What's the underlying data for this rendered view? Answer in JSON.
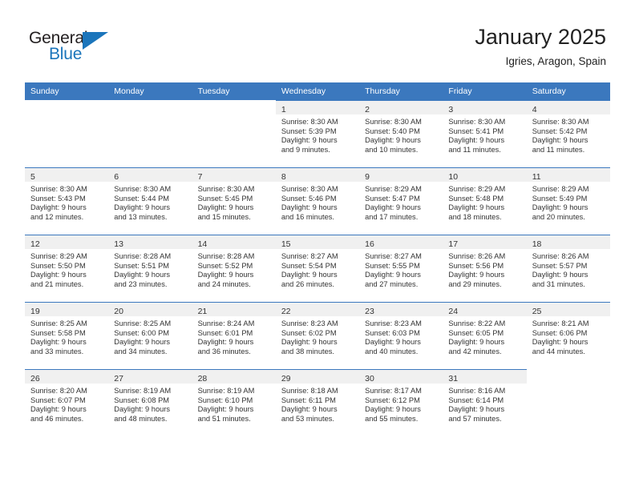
{
  "brand": {
    "name_part1": "General",
    "name_part2": "Blue",
    "accent_color": "#1b75bb"
  },
  "header": {
    "title": "January 2025",
    "subtitle": "Igries, Aragon, Spain"
  },
  "theme": {
    "header_row_color": "#3b78be",
    "cell_band_color": "#f0f0f0",
    "cell_top_border_color": "#3b78be"
  },
  "weekday_headers": [
    "Sunday",
    "Monday",
    "Tuesday",
    "Wednesday",
    "Thursday",
    "Friday",
    "Saturday"
  ],
  "weeks": [
    [
      {
        "day": "",
        "lines": [
          "",
          "",
          "",
          ""
        ],
        "empty": true
      },
      {
        "day": "",
        "lines": [
          "",
          "",
          "",
          ""
        ],
        "empty": true
      },
      {
        "day": "",
        "lines": [
          "",
          "",
          "",
          ""
        ],
        "empty": true
      },
      {
        "day": "1",
        "lines": [
          "Sunrise: 8:30 AM",
          "Sunset: 5:39 PM",
          "Daylight: 9 hours",
          "and 9 minutes."
        ],
        "empty": false
      },
      {
        "day": "2",
        "lines": [
          "Sunrise: 8:30 AM",
          "Sunset: 5:40 PM",
          "Daylight: 9 hours",
          "and 10 minutes."
        ],
        "empty": false
      },
      {
        "day": "3",
        "lines": [
          "Sunrise: 8:30 AM",
          "Sunset: 5:41 PM",
          "Daylight: 9 hours",
          "and 11 minutes."
        ],
        "empty": false
      },
      {
        "day": "4",
        "lines": [
          "Sunrise: 8:30 AM",
          "Sunset: 5:42 PM",
          "Daylight: 9 hours",
          "and 11 minutes."
        ],
        "empty": false
      }
    ],
    [
      {
        "day": "5",
        "lines": [
          "Sunrise: 8:30 AM",
          "Sunset: 5:43 PM",
          "Daylight: 9 hours",
          "and 12 minutes."
        ],
        "empty": false
      },
      {
        "day": "6",
        "lines": [
          "Sunrise: 8:30 AM",
          "Sunset: 5:44 PM",
          "Daylight: 9 hours",
          "and 13 minutes."
        ],
        "empty": false
      },
      {
        "day": "7",
        "lines": [
          "Sunrise: 8:30 AM",
          "Sunset: 5:45 PM",
          "Daylight: 9 hours",
          "and 15 minutes."
        ],
        "empty": false
      },
      {
        "day": "8",
        "lines": [
          "Sunrise: 8:30 AM",
          "Sunset: 5:46 PM",
          "Daylight: 9 hours",
          "and 16 minutes."
        ],
        "empty": false
      },
      {
        "day": "9",
        "lines": [
          "Sunrise: 8:29 AM",
          "Sunset: 5:47 PM",
          "Daylight: 9 hours",
          "and 17 minutes."
        ],
        "empty": false
      },
      {
        "day": "10",
        "lines": [
          "Sunrise: 8:29 AM",
          "Sunset: 5:48 PM",
          "Daylight: 9 hours",
          "and 18 minutes."
        ],
        "empty": false
      },
      {
        "day": "11",
        "lines": [
          "Sunrise: 8:29 AM",
          "Sunset: 5:49 PM",
          "Daylight: 9 hours",
          "and 20 minutes."
        ],
        "empty": false
      }
    ],
    [
      {
        "day": "12",
        "lines": [
          "Sunrise: 8:29 AM",
          "Sunset: 5:50 PM",
          "Daylight: 9 hours",
          "and 21 minutes."
        ],
        "empty": false
      },
      {
        "day": "13",
        "lines": [
          "Sunrise: 8:28 AM",
          "Sunset: 5:51 PM",
          "Daylight: 9 hours",
          "and 23 minutes."
        ],
        "empty": false
      },
      {
        "day": "14",
        "lines": [
          "Sunrise: 8:28 AM",
          "Sunset: 5:52 PM",
          "Daylight: 9 hours",
          "and 24 minutes."
        ],
        "empty": false
      },
      {
        "day": "15",
        "lines": [
          "Sunrise: 8:27 AM",
          "Sunset: 5:54 PM",
          "Daylight: 9 hours",
          "and 26 minutes."
        ],
        "empty": false
      },
      {
        "day": "16",
        "lines": [
          "Sunrise: 8:27 AM",
          "Sunset: 5:55 PM",
          "Daylight: 9 hours",
          "and 27 minutes."
        ],
        "empty": false
      },
      {
        "day": "17",
        "lines": [
          "Sunrise: 8:26 AM",
          "Sunset: 5:56 PM",
          "Daylight: 9 hours",
          "and 29 minutes."
        ],
        "empty": false
      },
      {
        "day": "18",
        "lines": [
          "Sunrise: 8:26 AM",
          "Sunset: 5:57 PM",
          "Daylight: 9 hours",
          "and 31 minutes."
        ],
        "empty": false
      }
    ],
    [
      {
        "day": "19",
        "lines": [
          "Sunrise: 8:25 AM",
          "Sunset: 5:58 PM",
          "Daylight: 9 hours",
          "and 33 minutes."
        ],
        "empty": false
      },
      {
        "day": "20",
        "lines": [
          "Sunrise: 8:25 AM",
          "Sunset: 6:00 PM",
          "Daylight: 9 hours",
          "and 34 minutes."
        ],
        "empty": false
      },
      {
        "day": "21",
        "lines": [
          "Sunrise: 8:24 AM",
          "Sunset: 6:01 PM",
          "Daylight: 9 hours",
          "and 36 minutes."
        ],
        "empty": false
      },
      {
        "day": "22",
        "lines": [
          "Sunrise: 8:23 AM",
          "Sunset: 6:02 PM",
          "Daylight: 9 hours",
          "and 38 minutes."
        ],
        "empty": false
      },
      {
        "day": "23",
        "lines": [
          "Sunrise: 8:23 AM",
          "Sunset: 6:03 PM",
          "Daylight: 9 hours",
          "and 40 minutes."
        ],
        "empty": false
      },
      {
        "day": "24",
        "lines": [
          "Sunrise: 8:22 AM",
          "Sunset: 6:05 PM",
          "Daylight: 9 hours",
          "and 42 minutes."
        ],
        "empty": false
      },
      {
        "day": "25",
        "lines": [
          "Sunrise: 8:21 AM",
          "Sunset: 6:06 PM",
          "Daylight: 9 hours",
          "and 44 minutes."
        ],
        "empty": false
      }
    ],
    [
      {
        "day": "26",
        "lines": [
          "Sunrise: 8:20 AM",
          "Sunset: 6:07 PM",
          "Daylight: 9 hours",
          "and 46 minutes."
        ],
        "empty": false
      },
      {
        "day": "27",
        "lines": [
          "Sunrise: 8:19 AM",
          "Sunset: 6:08 PM",
          "Daylight: 9 hours",
          "and 48 minutes."
        ],
        "empty": false
      },
      {
        "day": "28",
        "lines": [
          "Sunrise: 8:19 AM",
          "Sunset: 6:10 PM",
          "Daylight: 9 hours",
          "and 51 minutes."
        ],
        "empty": false
      },
      {
        "day": "29",
        "lines": [
          "Sunrise: 8:18 AM",
          "Sunset: 6:11 PM",
          "Daylight: 9 hours",
          "and 53 minutes."
        ],
        "empty": false
      },
      {
        "day": "30",
        "lines": [
          "Sunrise: 8:17 AM",
          "Sunset: 6:12 PM",
          "Daylight: 9 hours",
          "and 55 minutes."
        ],
        "empty": false
      },
      {
        "day": "31",
        "lines": [
          "Sunrise: 8:16 AM",
          "Sunset: 6:14 PM",
          "Daylight: 9 hours",
          "and 57 minutes."
        ],
        "empty": false
      },
      {
        "day": "",
        "lines": [
          "",
          "",
          "",
          ""
        ],
        "empty": true
      }
    ]
  ]
}
